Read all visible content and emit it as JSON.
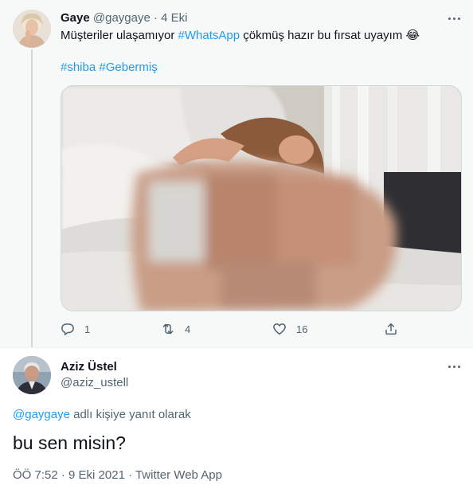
{
  "parent_tweet": {
    "author_name": "Gaye",
    "author_handle": "@gaygaye",
    "separator": "·",
    "date": "4 Eki",
    "text_before": "Müşteriler ulaşamıyor ",
    "hashtag": "#WhatsApp",
    "text_after": " çökmüş hazır bu fırsat uyayım ",
    "emoji": "😂",
    "tags": [
      "#shiba",
      "#Gebermiş"
    ],
    "counts": {
      "replies": "1",
      "retweets": "4",
      "likes": "16"
    },
    "colors": {
      "link": "#1d9bf0",
      "muted": "#536471",
      "background": "#f7f9f9"
    }
  },
  "reply_tweet": {
    "author_name": "Aziz Üstel",
    "author_handle": "@aziz_ustell",
    "replying_to_handle": "@gaygaye",
    "replying_to_suffix": " adlı kişiye yanıt olarak",
    "text": "bu sen misin?",
    "meta": "ÖÖ 7:52 · 9 Eki 2021 · Twitter Web App"
  },
  "icons": [
    "more-icon",
    "reply-icon",
    "retweet-icon",
    "like-icon",
    "share-icon"
  ]
}
